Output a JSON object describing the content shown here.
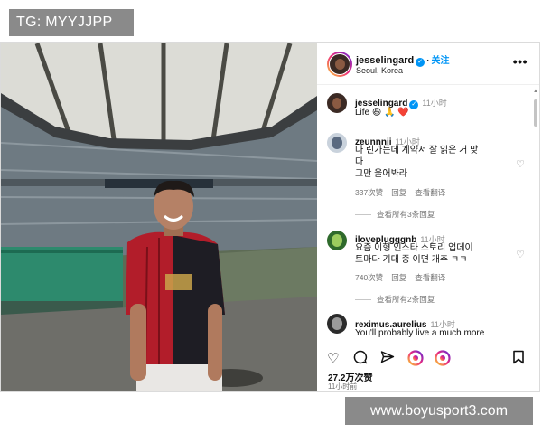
{
  "watermark_top": "TG: MYYJJPP",
  "watermark_bottom": "www.boyusport3.com",
  "post": {
    "username": "jesselingard",
    "location": "Seoul, Korea",
    "follow_label": "关注",
    "more_label": "•••"
  },
  "caption": {
    "username": "jesselingard",
    "time": "11小时",
    "text": "Life 😆 🙏 ❤️"
  },
  "comments": [
    {
      "username": "zeunnnii",
      "time": "11小时",
      "lines": [
        "나 린가든데 계약서 잘 읽은 거 맞",
        "다",
        "그만 울어봐라"
      ],
      "likes": "337次赞",
      "reply_label": "回复",
      "translate_label": "查看翻译",
      "view_replies": "查看所有3条回复"
    },
    {
      "username": "iloveplugggnb",
      "time": "11小时",
      "lines": [
        "요즘 이형 인스타 스토리 업데이",
        "트마다 기대 중 이면 개추 ㅋㅋ"
      ],
      "likes": "740次赞",
      "reply_label": "回复",
      "translate_label": "查看翻译",
      "view_replies": "查看所有2条回复"
    },
    {
      "username": "reximus.aurelius",
      "time": "11小时",
      "lines": [
        "You'll probably live a much more"
      ]
    }
  ],
  "actions": {
    "likes_count": "27.2万次赞",
    "posted_time": "11小时前"
  }
}
